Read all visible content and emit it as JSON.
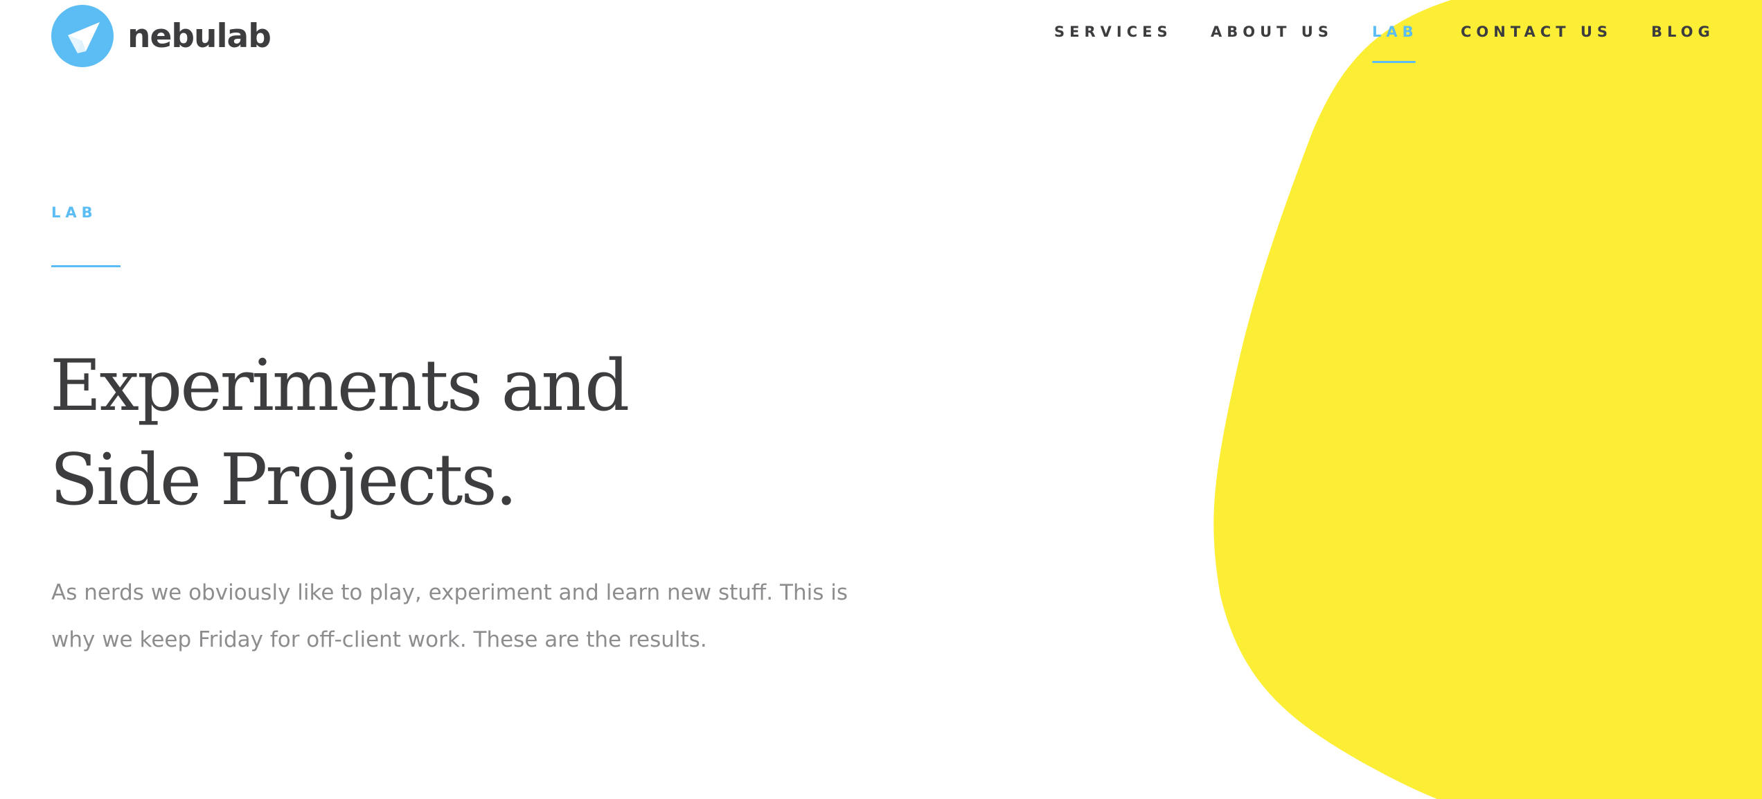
{
  "brand": {
    "name": "nebulab",
    "logo_icon": "paper-plane-icon"
  },
  "nav": {
    "items": [
      {
        "label": "SERVICES",
        "active": false
      },
      {
        "label": "ABOUT US",
        "active": false
      },
      {
        "label": "LAB",
        "active": true
      },
      {
        "label": "CONTACT US",
        "active": false
      },
      {
        "label": "BLOG",
        "active": false
      }
    ]
  },
  "hero": {
    "eyebrow": "LAB",
    "headline_line1": "Experiments and",
    "headline_line2": "Side Projects.",
    "lead": "As nerds we obviously like to play, experiment and learn new stuff. This is why we keep Friday for off-client work. These are the results."
  },
  "colors": {
    "accent": "#5bbdf4",
    "blob": "#fcee34",
    "text_dark": "#3d3d3f",
    "text_muted": "#8d8d8f",
    "background": "#ffffff"
  }
}
